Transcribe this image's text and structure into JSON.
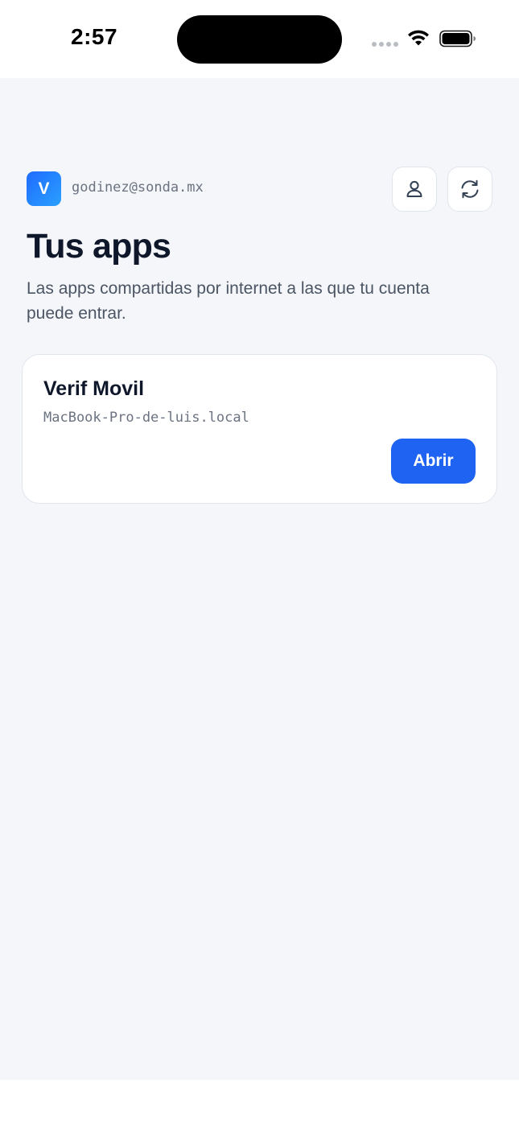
{
  "status_bar": {
    "time": "2:57"
  },
  "account": {
    "avatar_initial": "V",
    "email": "godinez@sonda.mx"
  },
  "header": {
    "title": "Tus apps",
    "subtitle": "Las apps compartidas por internet a las que tu cuenta puede entrar."
  },
  "apps": [
    {
      "name": "Verif Movil",
      "host": "MacBook-Pro-de-luis.local",
      "open_label": "Abrir"
    }
  ],
  "icons": {
    "account": "person-icon",
    "refresh": "refresh-icon",
    "wifi": "wifi-icon",
    "battery": "battery-icon"
  },
  "colors": {
    "accent": "#1f63f2",
    "background": "#f4f6fa",
    "title": "#0f172a",
    "muted": "#6b7280"
  }
}
